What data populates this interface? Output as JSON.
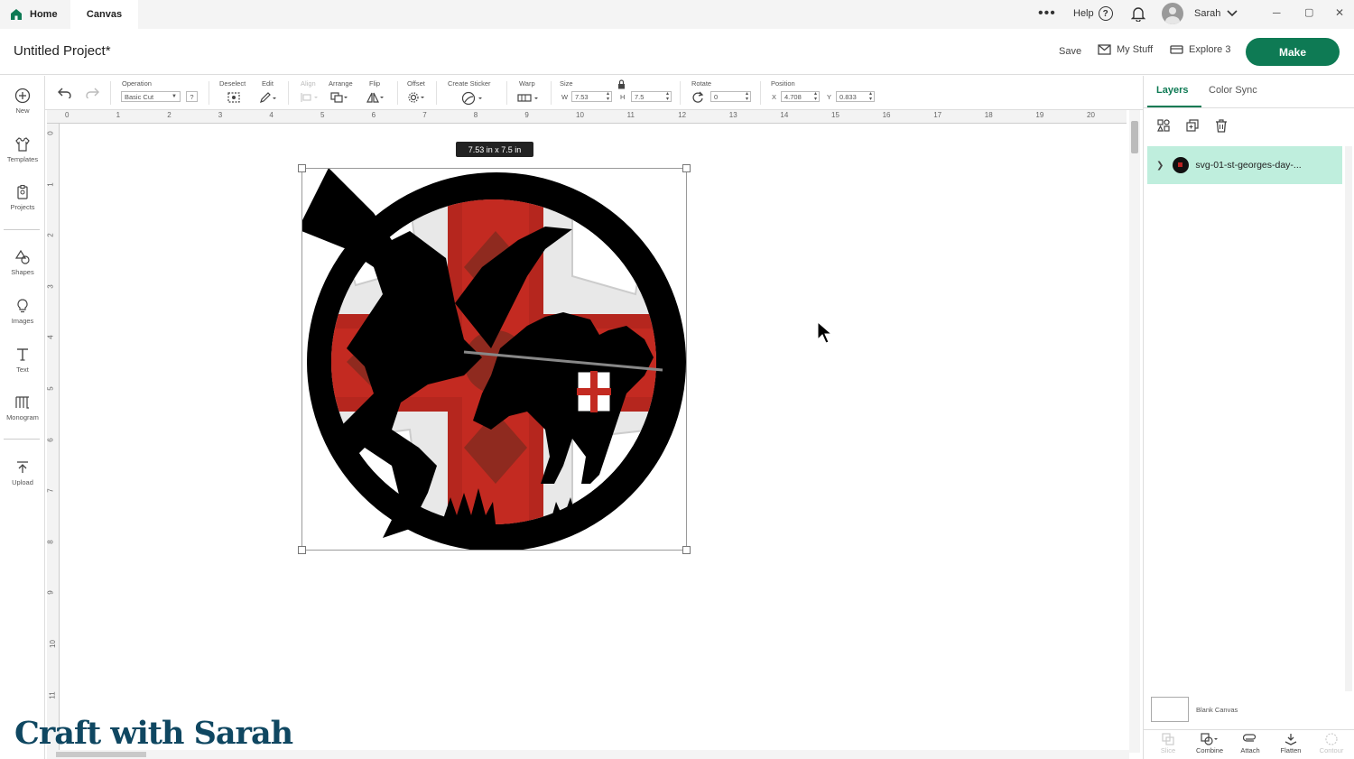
{
  "tabs": {
    "home": "Home",
    "canvas": "Canvas"
  },
  "topbar": {
    "more": "•••",
    "help": "Help",
    "help_mark": "?",
    "user": "Sarah",
    "win_min": "─",
    "win_max": "▢",
    "win_close": "✕"
  },
  "header": {
    "title": "Untitled Project*",
    "save": "Save",
    "my_stuff": "My Stuff",
    "explore": "Explore 3",
    "make": "Make"
  },
  "toolbar": {
    "operation_label": "Operation",
    "operation_value": "Basic Cut",
    "operation_help": "?",
    "deselect_label": "Deselect",
    "edit_label": "Edit",
    "align_label": "Align",
    "arrange_label": "Arrange",
    "flip_label": "Flip",
    "offset_label": "Offset",
    "sticker_label": "Create Sticker",
    "warp_label": "Warp",
    "size_label": "Size",
    "w_label": "W",
    "w_value": "7.53",
    "h_label": "H",
    "h_value": "7.5",
    "rotate_label": "Rotate",
    "rotate_value": "0",
    "position_label": "Position",
    "x_label": "X",
    "x_value": "4.708",
    "y_label": "Y",
    "y_value": "0.833"
  },
  "leftnav": [
    {
      "label": "New",
      "icon": "plus-circle-icon"
    },
    {
      "label": "Templates",
      "icon": "shirt-icon"
    },
    {
      "label": "Projects",
      "icon": "clipboard-icon"
    },
    {
      "label": "Shapes",
      "icon": "shapes-icon"
    },
    {
      "label": "Images",
      "icon": "lightbulb-icon"
    },
    {
      "label": "Text",
      "icon": "text-icon"
    },
    {
      "label": "Monogram",
      "icon": "monogram-icon"
    },
    {
      "label": "Upload",
      "icon": "upload-icon"
    }
  ],
  "ruler": {
    "top": [
      "0",
      "1",
      "2",
      "3",
      "4",
      "5",
      "6",
      "7",
      "8",
      "9",
      "10",
      "11",
      "12",
      "13",
      "14",
      "15",
      "16",
      "17",
      "18",
      "19",
      "20"
    ],
    "left": [
      "0",
      "1",
      "2",
      "3",
      "4",
      "5",
      "6",
      "7",
      "8",
      "9",
      "10",
      "11"
    ]
  },
  "canvas": {
    "size_tooltip": "7.53  in x 7.5  in"
  },
  "watermark": "Craft with Sarah",
  "rightpanel": {
    "tab_layers": "Layers",
    "tab_color_sync": "Color Sync",
    "layer_name": "svg-01-st-georges-day-...",
    "blank_canvas": "Blank Canvas",
    "bottom": [
      "Slice",
      "Combine",
      "Attach",
      "Flatten",
      "Contour"
    ]
  },
  "colors": {
    "accent": "#0e7a54",
    "layer_selected": "#bfeedd",
    "flag_red": "#b5261e",
    "flag_dark_red": "#8f2a1f"
  }
}
